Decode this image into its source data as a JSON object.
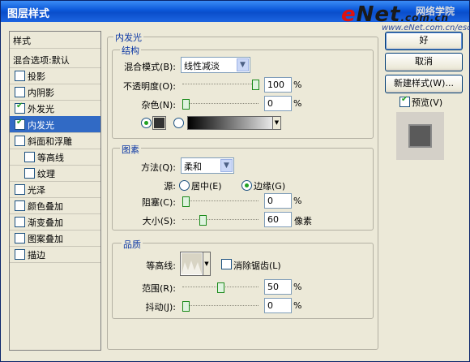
{
  "window": {
    "title": "图层样式"
  },
  "watermark": {
    "brand_e": "e",
    "brand_rest": "Net",
    "brand_suffix": ".com.cn",
    "sub": "网络学院",
    "url": "www.eNet.com.cn/eschool"
  },
  "left_panel": {
    "header": "样式",
    "blend_default": "混合选项:默认",
    "items": [
      {
        "label": "投影",
        "checked": false,
        "indent": false,
        "selected": false
      },
      {
        "label": "内阴影",
        "checked": false,
        "indent": false,
        "selected": false
      },
      {
        "label": "外发光",
        "checked": true,
        "indent": false,
        "selected": false
      },
      {
        "label": "内发光",
        "checked": true,
        "indent": false,
        "selected": true
      },
      {
        "label": "斜面和浮雕",
        "checked": false,
        "indent": false,
        "selected": false
      },
      {
        "label": "等高线",
        "checked": false,
        "indent": true,
        "selected": false
      },
      {
        "label": "纹理",
        "checked": false,
        "indent": true,
        "selected": false
      },
      {
        "label": "光泽",
        "checked": false,
        "indent": false,
        "selected": false
      },
      {
        "label": "颜色叠加",
        "checked": false,
        "indent": false,
        "selected": false
      },
      {
        "label": "渐变叠加",
        "checked": false,
        "indent": false,
        "selected": false
      },
      {
        "label": "图案叠加",
        "checked": false,
        "indent": false,
        "selected": false
      },
      {
        "label": "描边",
        "checked": false,
        "indent": false,
        "selected": false
      }
    ]
  },
  "main": {
    "section_title": "内发光",
    "structure": {
      "title": "结构",
      "blend_mode_label": "混合模式(B):",
      "blend_mode_value": "线性减淡",
      "opacity_label": "不透明度(O):",
      "opacity_value": "100",
      "opacity_fraction": 1.0,
      "noise_label": "杂色(N):",
      "noise_value": "0",
      "noise_fraction": 0.0,
      "unit": "%",
      "color_swatch": "#333333"
    },
    "elements": {
      "title": "图素",
      "method_label": "方法(Q):",
      "method_value": "柔和",
      "source_label": "源:",
      "source_center": "居中(E)",
      "source_edge": "边缘(G)",
      "choke_label": "阻塞(C):",
      "choke_value": "0",
      "choke_fraction": 0.0,
      "size_label": "大小(S):",
      "size_value": "60",
      "size_fraction": 0.24,
      "choke_unit": "%",
      "size_unit": "像素"
    },
    "quality": {
      "title": "品质",
      "contour_label": "等高线:",
      "antialias_label": "消除锯齿(L)",
      "range_label": "范围(R):",
      "range_value": "50",
      "range_fraction": 0.5,
      "jitter_label": "抖动(J):",
      "jitter_value": "0",
      "jitter_fraction": 0.0,
      "unit": "%"
    }
  },
  "buttons": {
    "ok": "好",
    "cancel": "取消",
    "new_style": "新建样式(W)...",
    "preview": "预览(V)"
  },
  "colors": {
    "accent": "#316ac5",
    "title_bar": "#0b57d8",
    "check": "#21a121"
  }
}
